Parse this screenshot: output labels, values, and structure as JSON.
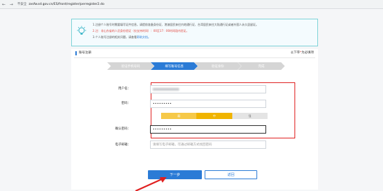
{
  "browser": {
    "nav_arrows": "← →",
    "security_label": "不安全",
    "url": "zxsfw.sd.gov.cn/ES/front/register/perregister2.do"
  },
  "notice": {
    "line1": "1.注册个人账号时需要填写证件信息，请提前准备身份证、港澳居民来往内地通行证、台湾居民来往大陆通行证或者外国人永久居留证。",
    "line2": "2.注：非山东省的人员身份验证（仅支持时间）：00至17：00时间段内验证。",
    "line3_prefix": "3.个人账号注册的相关问题，请查看",
    "line3_link": "帮助文档。"
  },
  "card": {
    "title": "账号注册",
    "required_prefix": "以下带",
    "required_mark": "*",
    "required_suffix": "为必填项"
  },
  "steps": [
    "验证手机号码",
    "填写账号信息",
    "验证身份",
    "完成"
  ],
  "form": {
    "username_label": "用户名：",
    "password_label": "密码：",
    "password_value": "•••••••••",
    "strength": [
      "弱",
      "中",
      "强"
    ],
    "confirm_label": "确认密码：",
    "confirm_value": "•••••••••",
    "email_label": "电子邮箱：",
    "email_placeholder": "请填写电子邮箱，可通过邮箱方式找回密码"
  },
  "buttons": {
    "next": "下一步",
    "back": "返回"
  },
  "colors": {
    "accent": "#2b7bd6",
    "highlight": "#e02020",
    "notice_border": "#7dd3d8",
    "strength_mid": "#f0b400"
  },
  "icons": {
    "notice": "lightbulb-icon",
    "annotation": "arrow-pointer-icon"
  }
}
